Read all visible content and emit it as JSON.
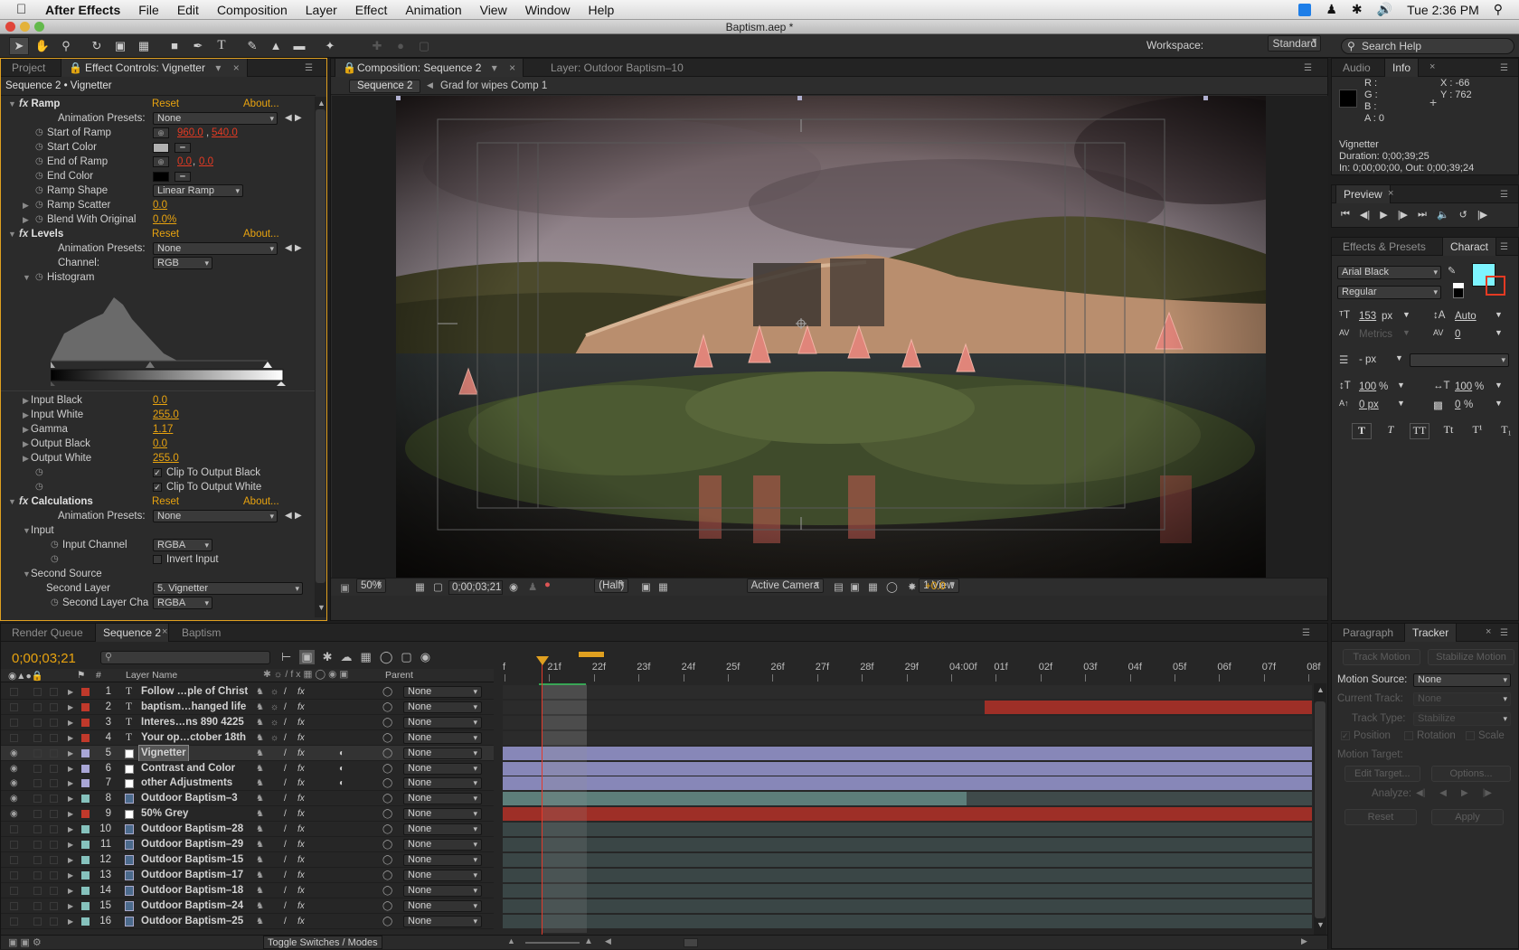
{
  "menubar": {
    "app": "After Effects",
    "items": [
      "File",
      "Edit",
      "Composition",
      "Layer",
      "Effect",
      "Animation",
      "View",
      "Window",
      "Help"
    ],
    "clock": "Tue 2:36 PM"
  },
  "window": {
    "title": "Baptism.aep *"
  },
  "toolbar": {
    "workspace_label": "Workspace:",
    "workspace_value": "Standard",
    "search_placeholder": "Search Help"
  },
  "left_panel": {
    "tabs": [
      "Project",
      "Effect Controls: Vignetter"
    ],
    "header": "Sequence 2 • Vignetter",
    "reset": "Reset",
    "about": "About...",
    "anim_presets": "Animation Presets:",
    "none": "None",
    "ramp": {
      "title": "Ramp",
      "start_of_ramp": "Start of Ramp",
      "start_x": "960.0",
      "start_y": "540.0",
      "start_color": "Start Color",
      "end_of_ramp": "End of Ramp",
      "end_x": "0.0",
      "end_y": "0.0",
      "end_color": "End Color",
      "ramp_shape": "Ramp Shape",
      "ramp_shape_val": "Linear Ramp",
      "ramp_scatter": "Ramp Scatter",
      "ramp_scatter_val": "0.0",
      "blend": "Blend With Original",
      "blend_val": "0.0%"
    },
    "levels": {
      "title": "Levels",
      "channel": "Channel:",
      "channel_val": "RGB",
      "histogram": "Histogram",
      "input_black": "Input Black",
      "input_black_val": "0.0",
      "input_white": "Input White",
      "input_white_val": "255.0",
      "gamma": "Gamma",
      "gamma_val": "1.17",
      "output_black": "Output Black",
      "output_black_val": "0.0",
      "output_white": "Output White",
      "output_white_val": "255.0",
      "clip_black": "Clip To Output Black",
      "clip_white": "Clip To Output White"
    },
    "calc": {
      "title": "Calculations",
      "input": "Input",
      "input_channel": "Input Channel",
      "input_channel_val": "RGBA",
      "invert": "Invert Input",
      "second_source": "Second Source",
      "second_layer": "Second Layer",
      "second_layer_val": "5. Vignetter",
      "second_layer_cha": "Second Layer Cha",
      "second_layer_cha_val": "RGBA"
    }
  },
  "comp": {
    "tab": "Composition: Sequence 2",
    "layer_tab": "Layer: Outdoor Baptism–10",
    "breadcrumb_active": "Sequence 2",
    "breadcrumb_next": "Grad for wipes Comp 1",
    "zoom": "50%",
    "timecode": "0;00;03;21",
    "resolution": "(Half)",
    "camera": "Active Camera",
    "view": "1 View",
    "exposure": "+0.0"
  },
  "info": {
    "tabs": [
      "Audio",
      "Info"
    ],
    "r": "R :",
    "g": "G :",
    "b": "B :",
    "a": "A : 0",
    "x": "X : -66",
    "y": "Y : 762",
    "layer": "Vignetter",
    "duration": "Duration: 0;00;39;25",
    "inout": "In: 0;00;00;00, Out: 0;00;39;24"
  },
  "preview": {
    "tab": "Preview"
  },
  "character": {
    "tabs": [
      "Effects & Presets",
      "Charact"
    ],
    "font": "Arial Black",
    "style": "Regular",
    "size": "153",
    "size_unit": "px",
    "leading": "Auto",
    "kerning": "Metrics",
    "tracking": "0",
    "stroke": "- px",
    "vscale": "100",
    "hscale": "100",
    "pct": "%",
    "baseline": "0 px",
    "tsume": "0",
    "fill_color": "#7df4ff"
  },
  "tracker": {
    "tabs": [
      "Paragraph",
      "Tracker"
    ],
    "track_motion": "Track Motion",
    "stabilize_motion": "Stabilize Motion",
    "motion_source": "Motion Source:",
    "motion_source_val": "None",
    "current_track": "Current Track:",
    "current_track_val": "None",
    "track_type": "Track Type:",
    "track_type_val": "Stabilize",
    "position": "Position",
    "rotation": "Rotation",
    "scale": "Scale",
    "motion_target": "Motion Target:",
    "edit_target": "Edit Target...",
    "options": "Options...",
    "analyze": "Analyze:",
    "reset": "Reset",
    "apply": "Apply"
  },
  "timeline": {
    "tabs": [
      "Render Queue",
      "Sequence 2",
      "Baptism"
    ],
    "timecode": "0;00;03;21",
    "col_name": "Layer Name",
    "col_parent": "Parent",
    "toggle": "Toggle Switches / Modes",
    "ruler": [
      "f",
      "21f",
      "22f",
      "23f",
      "24f",
      "25f",
      "26f",
      "27f",
      "28f",
      "29f",
      "04:00f",
      "01f",
      "02f",
      "03f",
      "04f",
      "05f",
      "06f",
      "07f",
      "08f"
    ],
    "layers": [
      {
        "num": "1",
        "name": "Follow …ple of Christ",
        "color": "#c0392b",
        "type": "T"
      },
      {
        "num": "2",
        "name": "baptism…hanged life",
        "color": "#c0392b",
        "type": "T"
      },
      {
        "num": "3",
        "name": "Interes…ns 890 4225",
        "color": "#c0392b",
        "type": "T"
      },
      {
        "num": "4",
        "name": "Your op…ctober 18th",
        "color": "#c0392b",
        "type": "T"
      },
      {
        "num": "5",
        "name": "Vignetter",
        "color": "#a9a6d6",
        "type": "solid"
      },
      {
        "num": "6",
        "name": "Contrast and Color",
        "color": "#a9a6d6",
        "type": "solid"
      },
      {
        "num": "7",
        "name": "other Adjustments",
        "color": "#a9a6d6",
        "type": "solid"
      },
      {
        "num": "8",
        "name": "Outdoor Baptism–3",
        "color": "#86c2bd",
        "type": "comp"
      },
      {
        "num": "9",
        "name": "50% Grey",
        "color": "#c0392b",
        "type": "solid"
      },
      {
        "num": "10",
        "name": "Outdoor Baptism–28",
        "color": "#86c2bd",
        "type": "comp"
      },
      {
        "num": "11",
        "name": "Outdoor Baptism–29",
        "color": "#86c2bd",
        "type": "comp"
      },
      {
        "num": "12",
        "name": "Outdoor Baptism–15",
        "color": "#86c2bd",
        "type": "comp"
      },
      {
        "num": "13",
        "name": "Outdoor Baptism–17",
        "color": "#86c2bd",
        "type": "comp"
      },
      {
        "num": "14",
        "name": "Outdoor Baptism–18",
        "color": "#86c2bd",
        "type": "comp"
      },
      {
        "num": "15",
        "name": "Outdoor Baptism–24",
        "color": "#86c2bd",
        "type": "comp"
      },
      {
        "num": "16",
        "name": "Outdoor Baptism–25",
        "color": "#86c2bd",
        "type": "comp"
      }
    ],
    "parent_value": "None"
  }
}
